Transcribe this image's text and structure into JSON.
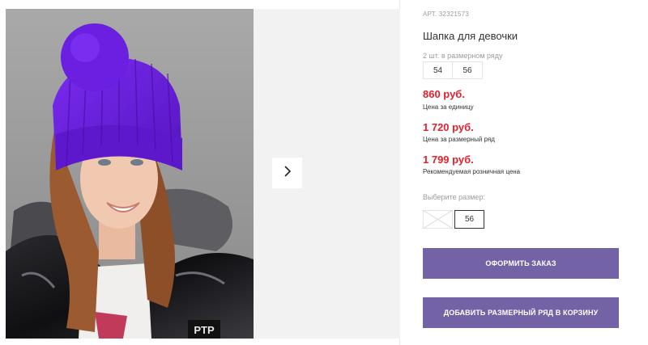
{
  "gallery": {
    "photo_alt": "",
    "next_icon": "chevron-right-icon",
    "badge_text": "PTP"
  },
  "product": {
    "sku_label": "АРТ.",
    "sku_value": "32321573",
    "title": "Шапка для девочки",
    "size_row_note": "2 шт. в размерном ряду",
    "size_row": [
      "54",
      "56"
    ]
  },
  "prices": [
    {
      "amount": "860 руб.",
      "caption": "Цена за единицу"
    },
    {
      "amount": "1 720 руб.",
      "caption": "Цена за размерный ряд"
    },
    {
      "amount": "1 799 руб.",
      "caption": "Рекомендуемая розничная цена"
    }
  ],
  "size_picker": {
    "label": "Выберите размер:",
    "options": [
      {
        "value": "54",
        "available": false
      },
      {
        "value": "56",
        "available": true,
        "selected": true
      }
    ]
  },
  "actions": {
    "order_label": "ОФОРМИТЬ ЗАКАЗ",
    "add_row_label": "ДОБАВИТЬ РАЗМЕРНЫЙ РЯД В КОРЗИНУ"
  },
  "colors": {
    "accent_button": "#7462a7",
    "price_red": "#e3202d",
    "hat_purple": "#6a1fd6"
  }
}
